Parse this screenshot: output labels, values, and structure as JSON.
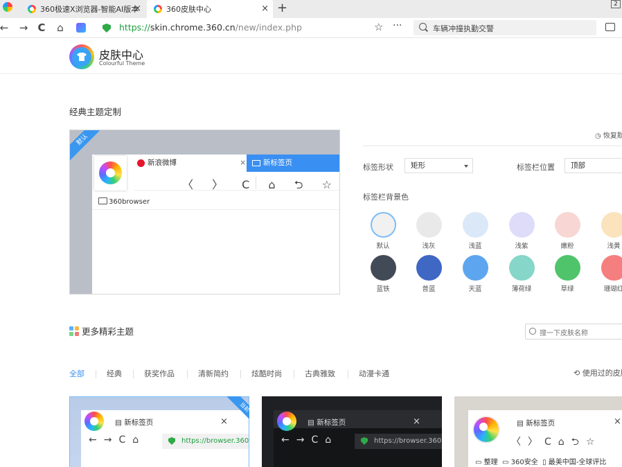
{
  "browser": {
    "tabs": [
      {
        "title": "360极速X浏览器-智能AI版本",
        "close": "×"
      },
      {
        "title": "360皮肤中心",
        "close": "×"
      }
    ],
    "new_tab": "+",
    "window_btn": "2",
    "nav": {
      "back": "←",
      "forward": "→",
      "reload": "C",
      "home": "⌂"
    },
    "url": {
      "scheme": "https://",
      "domain": "skin.chrome.360.cn",
      "path": "/new/index.php"
    },
    "star": "☆",
    "menu": "···",
    "search_text": "车辆冲撞执勤交警"
  },
  "header": {
    "title": "皮肤中心",
    "subtitle": "Colourful Theme"
  },
  "classic": {
    "title": "经典主题定制",
    "ribbon": "默认",
    "preview": {
      "tab1": "新浪微博",
      "tab1_close": "×",
      "tab2": "新标签页",
      "nav_icons": "〈 〉 C ⌂ ⮌ ☆",
      "bookmark": "360browser"
    },
    "reset": "恢复默认",
    "tab_shape_label": "标签形状",
    "tab_shape_value": "矩形",
    "tab_position_label": "标签栏位置",
    "tab_position_value": "顶部",
    "bg_color_label": "标签栏背景色",
    "colors": [
      {
        "name": "默认",
        "hex": "#f1f1f1"
      },
      {
        "name": "浅灰",
        "hex": "#e9e9e9"
      },
      {
        "name": "浅蓝",
        "hex": "#dbe8f8"
      },
      {
        "name": "浅紫",
        "hex": "#dedcf9"
      },
      {
        "name": "嫩粉",
        "hex": "#f7d6d4"
      },
      {
        "name": "浅黄",
        "hex": "#fbe3bd"
      },
      {
        "name": "蓝铁",
        "hex": "#434a57"
      },
      {
        "name": "普蓝",
        "hex": "#3f67c4"
      },
      {
        "name": "天蓝",
        "hex": "#5ea5ef"
      },
      {
        "name": "薄荷绿",
        "hex": "#86d6c9"
      },
      {
        "name": "草绿",
        "hex": "#4fc46b"
      },
      {
        "name": "珊瑚红",
        "hex": "#f57e7e"
      }
    ]
  },
  "more": {
    "title": "更多精彩主题",
    "search_placeholder": "搜一下皮肤名称",
    "categories": [
      "全部",
      "经典",
      "获奖作品",
      "清新简约",
      "炫酷时尚",
      "古典雅致",
      "动漫卡通"
    ],
    "used": "使用过的皮肤",
    "cards": [
      {
        "tab": "新标签页",
        "close": "×",
        "nav": "←→C⌂",
        "url": "https://browser.360",
        "ribbon": "当前"
      },
      {
        "tab": "新标签页",
        "close": "×",
        "nav": "←→C⌂",
        "url": "https://browser.360"
      },
      {
        "tab": "新标签页",
        "close": "×",
        "nav": "〈〉C⌂⮌☆",
        "bookmarks": [
          "整理",
          "360安全",
          "最美中国-全球评比"
        ]
      }
    ]
  }
}
